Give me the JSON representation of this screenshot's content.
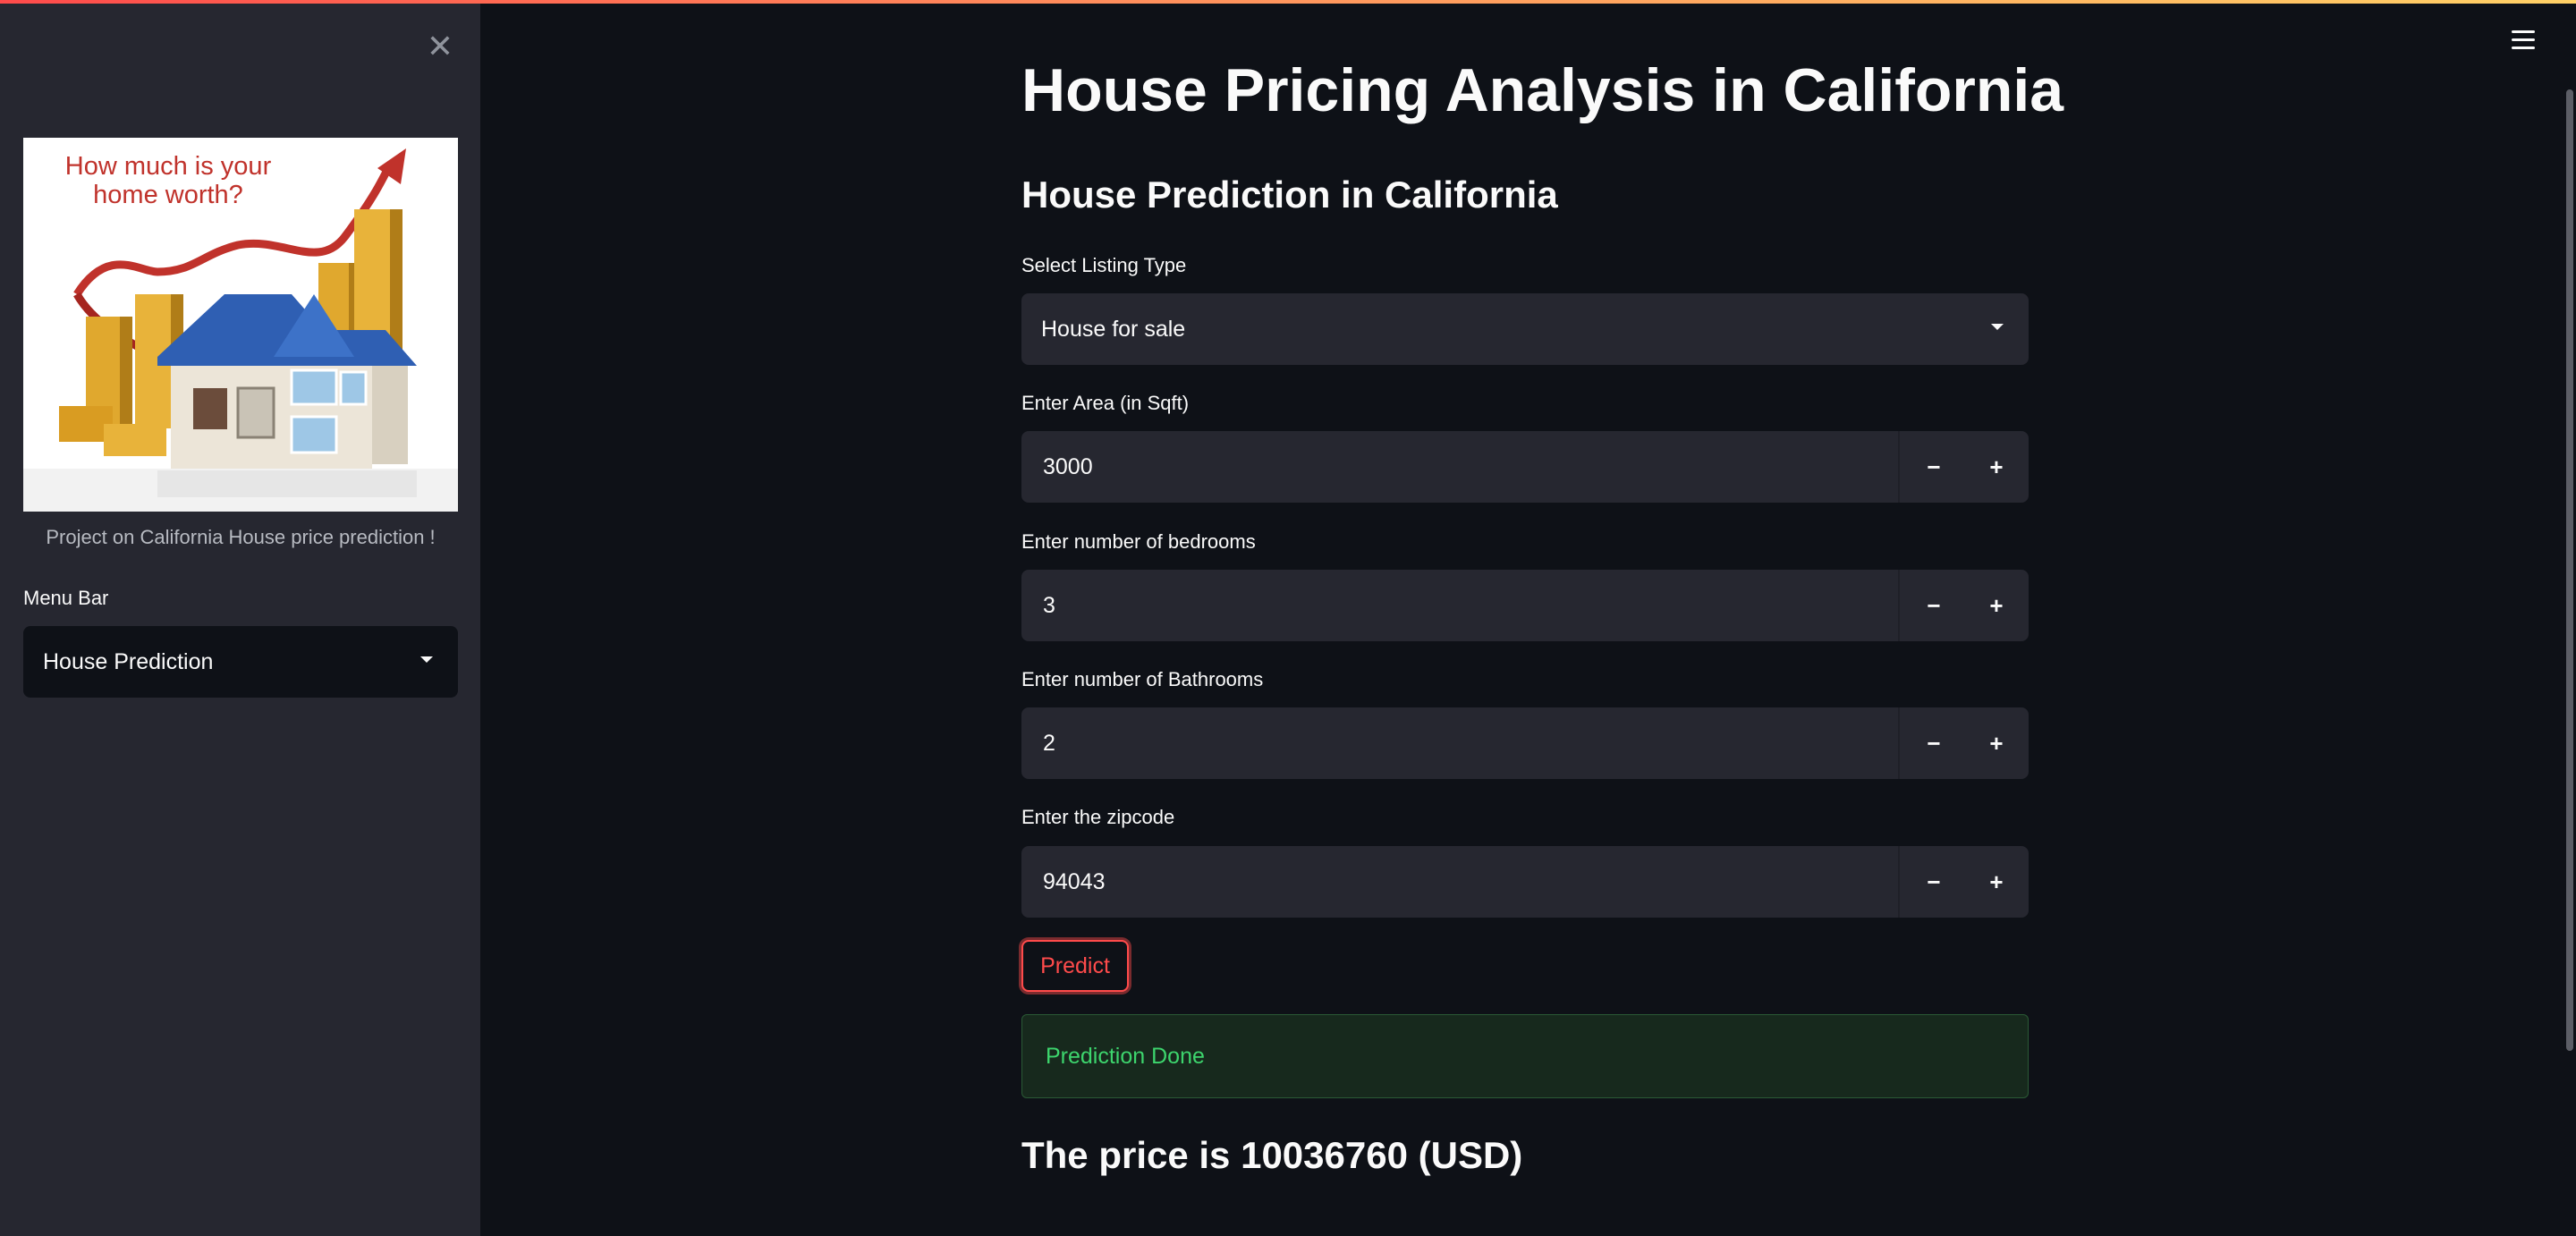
{
  "sidebar": {
    "close_icon": "close-icon",
    "hero_image": {
      "text": "How much is your home worth?",
      "icon": "house-price-chart-image"
    },
    "caption": "Project on California House price prediction !",
    "menu_label": "Menu Bar",
    "menu_selected": "House Prediction"
  },
  "header": {
    "menu_icon": "hamburger-menu-icon"
  },
  "main": {
    "title": "House Pricing Analysis in California",
    "subheader": "House Prediction in California",
    "listing_type": {
      "label": "Select Listing Type",
      "selected": "House for sale"
    },
    "area": {
      "label": "Enter Area (in Sqft)",
      "value": "3000"
    },
    "bedrooms": {
      "label": "Enter number of bedrooms",
      "value": "3"
    },
    "bathrooms": {
      "label": "Enter number of Bathrooms",
      "value": "2"
    },
    "zipcode": {
      "label": "Enter the zipcode",
      "value": "94043"
    },
    "stepper": {
      "minus": "−",
      "plus": "+"
    },
    "predict_button": "Predict",
    "success_message": "Prediction Done",
    "result": "The price is 10036760 (USD)"
  },
  "colors": {
    "background": "#0e1117",
    "sidebar": "#262730",
    "accent": "#ff4b4b",
    "success": "#3dd56d"
  }
}
